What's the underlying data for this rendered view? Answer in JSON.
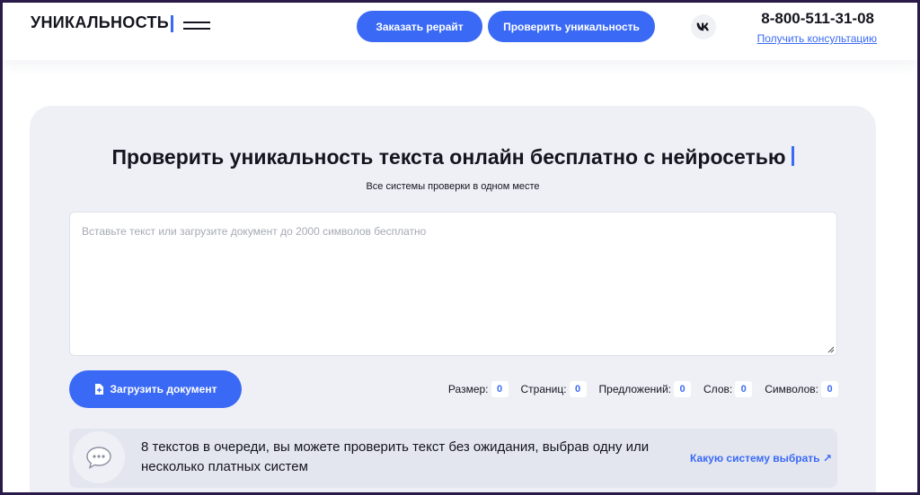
{
  "header": {
    "logo": "УНИКАЛЬНОСТЬ",
    "rewrite_button": "Заказать рерайт",
    "check_button": "Проверить уникальность",
    "social_icon": "vk-icon",
    "phone": "8-800-511-31-08",
    "consult_link": "Получить консультацию"
  },
  "main": {
    "title": "Проверить уникальность текста онлайн бесплатно с нейросетью",
    "subtitle": "Все системы проверки в одном месте",
    "textarea": {
      "value": "",
      "placeholder": "Вставьте текст или загрузите документ до 2000 символов бесплатно"
    },
    "upload_button": "Загрузить документ",
    "stats": [
      {
        "label": "Размер:",
        "value": "0"
      },
      {
        "label": "Страниц:",
        "value": "0"
      },
      {
        "label": "Предложений:",
        "value": "0"
      },
      {
        "label": "Слов:",
        "value": "0"
      },
      {
        "label": "Символов:",
        "value": "0"
      }
    ],
    "queue": {
      "icon": "chat-bubble-icon",
      "text": "8 текстов в очереди, вы можете проверить текст без ожидания, выбрав одну или несколько платных систем",
      "link": "Какую систему выбрать ↗"
    }
  },
  "colors": {
    "accent": "#3a6af5",
    "card_bg": "#eef0f6",
    "text": "#15151f"
  }
}
